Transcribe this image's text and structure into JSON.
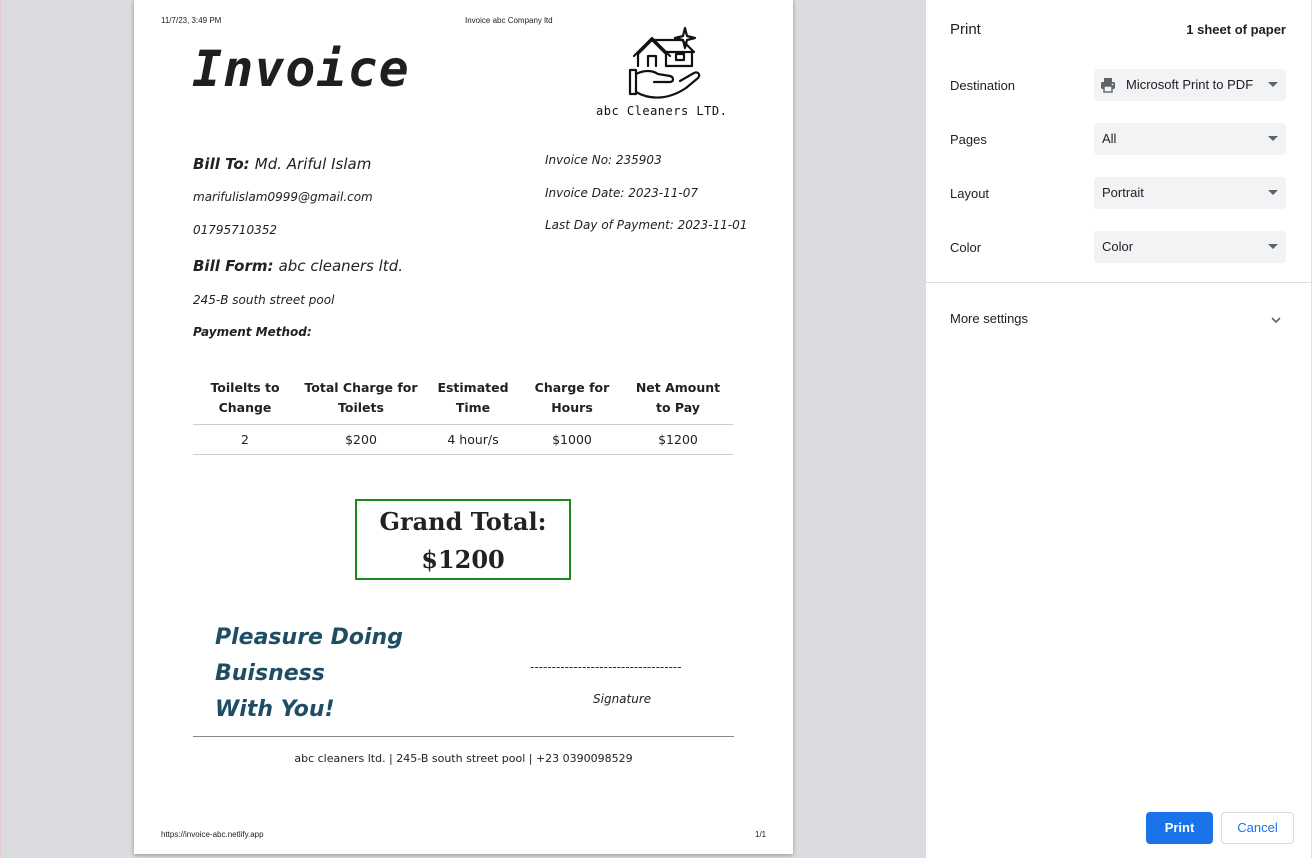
{
  "document": {
    "header_left": "11/7/23, 3:49 PM",
    "header_center": "Invoice abc Company ltd",
    "footer_left": "https://invoice-abc.netlify.app",
    "footer_right": "1/1",
    "title": "Invoice",
    "company_logo_icon": "house-in-hand-sparkle-icon",
    "company_name": "abc Cleaners LTD.",
    "bill_to_label": "Bill To:",
    "bill_to_name": "Md. Ariful Islam",
    "email": "marifulislam0999@gmail.com",
    "phone": "01795710352",
    "bill_from_label": "Bill Form:",
    "bill_from_name": "abc cleaners ltd.",
    "address": "245-B south street pool",
    "payment_method_label": "Payment Method:",
    "invoice_no": "Invoice No: 235903",
    "invoice_date": "Invoice Date: 2023-11-07",
    "last_payment_day": "Last Day of Payment: 2023-11-01",
    "table": {
      "headers": [
        "Toilelts to Change",
        "Total Charge for Toilets",
        "Estimated Time",
        "Charge for Hours",
        "Net Amount to Pay"
      ],
      "rows": [
        [
          "2",
          "$200",
          "4 hour/s",
          "$1000",
          "$1200"
        ]
      ]
    },
    "grand_total_label": "Grand Total:",
    "grand_total_value": "$1200",
    "thanks_line1": "Pleasure Doing Buisness",
    "thanks_line2": "With You!",
    "signature_line": "-----------------------------------",
    "signature_label": "Signature",
    "footer_info": "abc cleaners ltd. | 245-B south street pool | +23 0390098529",
    "grand_total_border_color": "#1a8a1a",
    "thanks_color": "#1f4e64"
  },
  "print_panel": {
    "title": "Print",
    "sheet_count": "1 sheet of paper",
    "destination_label": "Destination",
    "destination_value": "Microsoft Print to PDF",
    "destination_icon": "printer-icon",
    "pages_label": "Pages",
    "pages_value": "All",
    "layout_label": "Layout",
    "layout_value": "Portrait",
    "color_label": "Color",
    "color_value": "Color",
    "more_settings_label": "More settings",
    "more_settings_icon": "chevron-down-icon",
    "print_button": "Print",
    "cancel_button": "Cancel",
    "accent_color": "#1a73e8"
  }
}
